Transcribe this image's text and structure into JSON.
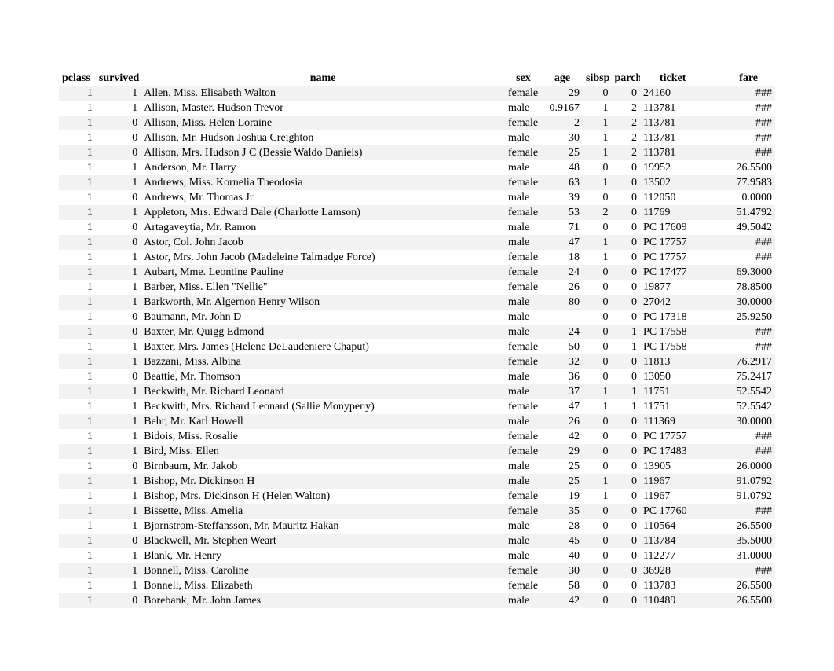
{
  "columns": {
    "pclass": "pclass",
    "survived": "survived",
    "name": "name",
    "sex": "sex",
    "age": "age",
    "sibsp": "sibsp",
    "parch": "parch",
    "ticket": "ticket",
    "fare": "fare"
  },
  "rows": [
    {
      "pclass": "1",
      "survived": "1",
      "name": "Allen, Miss. Elisabeth Walton",
      "sex": "female",
      "age": "29",
      "sibsp": "0",
      "parch": "0",
      "ticket": "24160",
      "fare": "###"
    },
    {
      "pclass": "1",
      "survived": "1",
      "name": "Allison, Master. Hudson Trevor",
      "sex": "male",
      "age": "0.9167",
      "sibsp": "1",
      "parch": "2",
      "ticket": "113781",
      "fare": "###"
    },
    {
      "pclass": "1",
      "survived": "0",
      "name": "Allison, Miss. Helen Loraine",
      "sex": "female",
      "age": "2",
      "sibsp": "1",
      "parch": "2",
      "ticket": "113781",
      "fare": "###"
    },
    {
      "pclass": "1",
      "survived": "0",
      "name": "Allison, Mr. Hudson Joshua Creighton",
      "sex": "male",
      "age": "30",
      "sibsp": "1",
      "parch": "2",
      "ticket": "113781",
      "fare": "###"
    },
    {
      "pclass": "1",
      "survived": "0",
      "name": "Allison, Mrs. Hudson J C (Bessie Waldo Daniels)",
      "sex": "female",
      "age": "25",
      "sibsp": "1",
      "parch": "2",
      "ticket": "113781",
      "fare": "###"
    },
    {
      "pclass": "1",
      "survived": "1",
      "name": "Anderson, Mr. Harry",
      "sex": "male",
      "age": "48",
      "sibsp": "0",
      "parch": "0",
      "ticket": "19952",
      "fare": "26.5500"
    },
    {
      "pclass": "1",
      "survived": "1",
      "name": "Andrews, Miss. Kornelia Theodosia",
      "sex": "female",
      "age": "63",
      "sibsp": "1",
      "parch": "0",
      "ticket": "13502",
      "fare": "77.9583"
    },
    {
      "pclass": "1",
      "survived": "0",
      "name": "Andrews, Mr. Thomas Jr",
      "sex": "male",
      "age": "39",
      "sibsp": "0",
      "parch": "0",
      "ticket": "112050",
      "fare": "0.0000"
    },
    {
      "pclass": "1",
      "survived": "1",
      "name": "Appleton, Mrs. Edward Dale (Charlotte Lamson)",
      "sex": "female",
      "age": "53",
      "sibsp": "2",
      "parch": "0",
      "ticket": "11769",
      "fare": "51.4792"
    },
    {
      "pclass": "1",
      "survived": "0",
      "name": "Artagaveytia, Mr. Ramon",
      "sex": "male",
      "age": "71",
      "sibsp": "0",
      "parch": "0",
      "ticket": "PC 17609",
      "fare": "49.5042"
    },
    {
      "pclass": "1",
      "survived": "0",
      "name": "Astor, Col. John Jacob",
      "sex": "male",
      "age": "47",
      "sibsp": "1",
      "parch": "0",
      "ticket": "PC 17757",
      "fare": "###"
    },
    {
      "pclass": "1",
      "survived": "1",
      "name": "Astor, Mrs. John Jacob (Madeleine Talmadge Force)",
      "sex": "female",
      "age": "18",
      "sibsp": "1",
      "parch": "0",
      "ticket": "PC 17757",
      "fare": "###"
    },
    {
      "pclass": "1",
      "survived": "1",
      "name": "Aubart, Mme. Leontine Pauline",
      "sex": "female",
      "age": "24",
      "sibsp": "0",
      "parch": "0",
      "ticket": "PC 17477",
      "fare": "69.3000"
    },
    {
      "pclass": "1",
      "survived": "1",
      "name": "Barber, Miss. Ellen \"Nellie\"",
      "sex": "female",
      "age": "26",
      "sibsp": "0",
      "parch": "0",
      "ticket": "19877",
      "fare": "78.8500"
    },
    {
      "pclass": "1",
      "survived": "1",
      "name": "Barkworth, Mr. Algernon Henry Wilson",
      "sex": "male",
      "age": "80",
      "sibsp": "0",
      "parch": "0",
      "ticket": "27042",
      "fare": "30.0000"
    },
    {
      "pclass": "1",
      "survived": "0",
      "name": "Baumann, Mr. John D",
      "sex": "male",
      "age": "",
      "sibsp": "0",
      "parch": "0",
      "ticket": "PC 17318",
      "fare": "25.9250"
    },
    {
      "pclass": "1",
      "survived": "0",
      "name": "Baxter, Mr. Quigg Edmond",
      "sex": "male",
      "age": "24",
      "sibsp": "0",
      "parch": "1",
      "ticket": "PC 17558",
      "fare": "###"
    },
    {
      "pclass": "1",
      "survived": "1",
      "name": "Baxter, Mrs. James (Helene DeLaudeniere Chaput)",
      "sex": "female",
      "age": "50",
      "sibsp": "0",
      "parch": "1",
      "ticket": "PC 17558",
      "fare": "###"
    },
    {
      "pclass": "1",
      "survived": "1",
      "name": "Bazzani, Miss. Albina",
      "sex": "female",
      "age": "32",
      "sibsp": "0",
      "parch": "0",
      "ticket": "11813",
      "fare": "76.2917"
    },
    {
      "pclass": "1",
      "survived": "0",
      "name": "Beattie, Mr. Thomson",
      "sex": "male",
      "age": "36",
      "sibsp": "0",
      "parch": "0",
      "ticket": "13050",
      "fare": "75.2417"
    },
    {
      "pclass": "1",
      "survived": "1",
      "name": "Beckwith, Mr. Richard Leonard",
      "sex": "male",
      "age": "37",
      "sibsp": "1",
      "parch": "1",
      "ticket": "11751",
      "fare": "52.5542"
    },
    {
      "pclass": "1",
      "survived": "1",
      "name": "Beckwith, Mrs. Richard Leonard (Sallie Monypeny)",
      "sex": "female",
      "age": "47",
      "sibsp": "1",
      "parch": "1",
      "ticket": "11751",
      "fare": "52.5542"
    },
    {
      "pclass": "1",
      "survived": "1",
      "name": "Behr, Mr. Karl Howell",
      "sex": "male",
      "age": "26",
      "sibsp": "0",
      "parch": "0",
      "ticket": "111369",
      "fare": "30.0000"
    },
    {
      "pclass": "1",
      "survived": "1",
      "name": "Bidois, Miss. Rosalie",
      "sex": "female",
      "age": "42",
      "sibsp": "0",
      "parch": "0",
      "ticket": "PC 17757",
      "fare": "###"
    },
    {
      "pclass": "1",
      "survived": "1",
      "name": "Bird, Miss. Ellen",
      "sex": "female",
      "age": "29",
      "sibsp": "0",
      "parch": "0",
      "ticket": "PC 17483",
      "fare": "###"
    },
    {
      "pclass": "1",
      "survived": "0",
      "name": "Birnbaum, Mr. Jakob",
      "sex": "male",
      "age": "25",
      "sibsp": "0",
      "parch": "0",
      "ticket": "13905",
      "fare": "26.0000"
    },
    {
      "pclass": "1",
      "survived": "1",
      "name": "Bishop, Mr. Dickinson H",
      "sex": "male",
      "age": "25",
      "sibsp": "1",
      "parch": "0",
      "ticket": "11967",
      "fare": "91.0792"
    },
    {
      "pclass": "1",
      "survived": "1",
      "name": "Bishop, Mrs. Dickinson H (Helen Walton)",
      "sex": "female",
      "age": "19",
      "sibsp": "1",
      "parch": "0",
      "ticket": "11967",
      "fare": "91.0792"
    },
    {
      "pclass": "1",
      "survived": "1",
      "name": "Bissette, Miss. Amelia",
      "sex": "female",
      "age": "35",
      "sibsp": "0",
      "parch": "0",
      "ticket": "PC 17760",
      "fare": "###"
    },
    {
      "pclass": "1",
      "survived": "1",
      "name": "Bjornstrom-Steffansson, Mr. Mauritz Hakan",
      "sex": "male",
      "age": "28",
      "sibsp": "0",
      "parch": "0",
      "ticket": "110564",
      "fare": "26.5500"
    },
    {
      "pclass": "1",
      "survived": "0",
      "name": "Blackwell, Mr. Stephen Weart",
      "sex": "male",
      "age": "45",
      "sibsp": "0",
      "parch": "0",
      "ticket": "113784",
      "fare": "35.5000"
    },
    {
      "pclass": "1",
      "survived": "1",
      "name": "Blank, Mr. Henry",
      "sex": "male",
      "age": "40",
      "sibsp": "0",
      "parch": "0",
      "ticket": "112277",
      "fare": "31.0000"
    },
    {
      "pclass": "1",
      "survived": "1",
      "name": "Bonnell, Miss. Caroline",
      "sex": "female",
      "age": "30",
      "sibsp": "0",
      "parch": "0",
      "ticket": "36928",
      "fare": "###"
    },
    {
      "pclass": "1",
      "survived": "1",
      "name": "Bonnell, Miss. Elizabeth",
      "sex": "female",
      "age": "58",
      "sibsp": "0",
      "parch": "0",
      "ticket": "113783",
      "fare": "26.5500"
    },
    {
      "pclass": "1",
      "survived": "0",
      "name": "Borebank, Mr. John James",
      "sex": "male",
      "age": "42",
      "sibsp": "0",
      "parch": "0",
      "ticket": "110489",
      "fare": "26.5500"
    }
  ]
}
